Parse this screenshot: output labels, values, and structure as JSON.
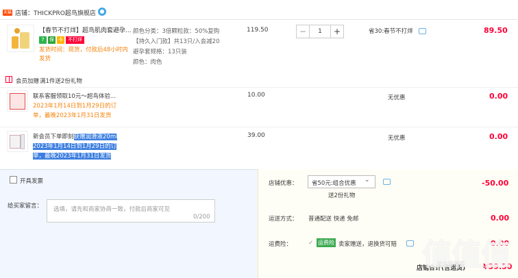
{
  "store": {
    "tag": "天猫",
    "name": "店铺：THICKPRO超鸟旗舰店",
    "chat_icon": "chat-icon"
  },
  "main_item": {
    "title": "【春节不打烊】超鸟肌肉套避孕...",
    "not_closed_badge": "不打烊",
    "ship_note": "发货时间：现货，付款后48小时内发货",
    "sku_lines": [
      "颜色分类：3倍颗粒款：50%复购",
      "【持久入门款】共13只/入会减20",
      "避孕套规格：13只装",
      "颜色：肉色"
    ],
    "price": "119.50",
    "quantity": "1",
    "promo": "省30:春节不打烊",
    "total": "89.50"
  },
  "gift_section": {
    "label": "会员加赠",
    "rule": "满1件送2份礼物"
  },
  "gifts": [
    {
      "title": "联系客服领取10元～超鸟体验...",
      "desc_lines": [
        "2023年1月14日到1月29日的订",
        "单，最晚2023年1月31日发货"
      ],
      "price": "10.00",
      "discount": "无优惠",
      "total": "0.00"
    },
    {
      "title_plain": "新会员下单即刻",
      "title_highlight": "获赠润滑液20ml",
      "desc_lines": [
        "2023年1月14日到1月29日的订",
        "单，最晚2023年1月31日发货"
      ],
      "price": "39.00",
      "discount": "无优惠",
      "total": "0.00"
    }
  ],
  "invoice": {
    "label": "开具发票"
  },
  "message": {
    "label": "给买家留言：",
    "placeholder": "选填，请先和商家协商一致，付款后商家可见",
    "count": "0/200"
  },
  "shop_discount": {
    "label": "店铺优惠：",
    "selected": "省50元:组合优惠",
    "gift_count": "送2份礼物",
    "amount": "-50.00"
  },
  "shipping": {
    "label": "运送方式：",
    "method": "普通配送 快递 免邮",
    "amount": "0.00"
  },
  "insurance": {
    "label": "运费险：",
    "badge": "运费险",
    "text": "卖家赠送，退换货可赔",
    "amount": "0.00"
  },
  "shop_total": {
    "label": "店铺合计(含运费)",
    "amount": "¥39.50"
  },
  "watermark": {
    "brand": "值值值",
    "sub": "什么值得买"
  }
}
